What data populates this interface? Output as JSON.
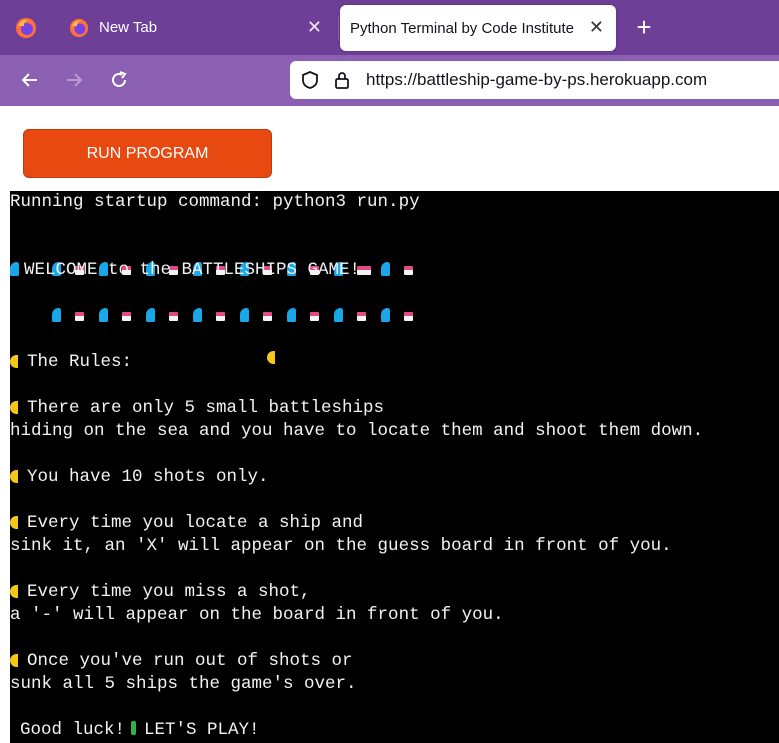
{
  "browser": {
    "tabs": [
      {
        "label": "New Tab",
        "active": false
      },
      {
        "label": "Python Terminal by Code Institute",
        "active": true
      }
    ],
    "url": "https://battleship-game-by-ps.herokuapp.com",
    "colors": {
      "tabbar": "#6e3f96",
      "navbar": "#8b5fb2"
    }
  },
  "page": {
    "run_button_label": "RUN PROGRAM",
    "run_button_color": "#e84910"
  },
  "terminal": {
    "startup": "Running startup command: python3 run.py",
    "welcome": "WELCOME to the BATTLESHIPS GAME!",
    "rules_heading": "The Rules:",
    "rule1_line1": "There are only 5 small battleships",
    "rule1_line2": "hiding on the sea and you have to locate them and shoot them down.",
    "rule2": "You have 10 shots only.",
    "rule3_line1": "Every time you locate a ship and",
    "rule3_line2": "sink it, an 'X' will appear on the guess board in front of you.",
    "rule4_line1": "Every time you miss a shot,",
    "rule4_line2": "a '-' will appear on the board in front of you.",
    "rule5_line1": "Once you've run out of shots or",
    "rule5_line2": "sunk all 5 ships the game's over.",
    "good_luck": "Good luck!",
    "lets_play": "LET'S PLAY!",
    "icons": [
      "wave-emoji",
      "ship-emoji",
      "crescent-moon-emoji",
      "four-leaf-clover-emoji"
    ]
  }
}
